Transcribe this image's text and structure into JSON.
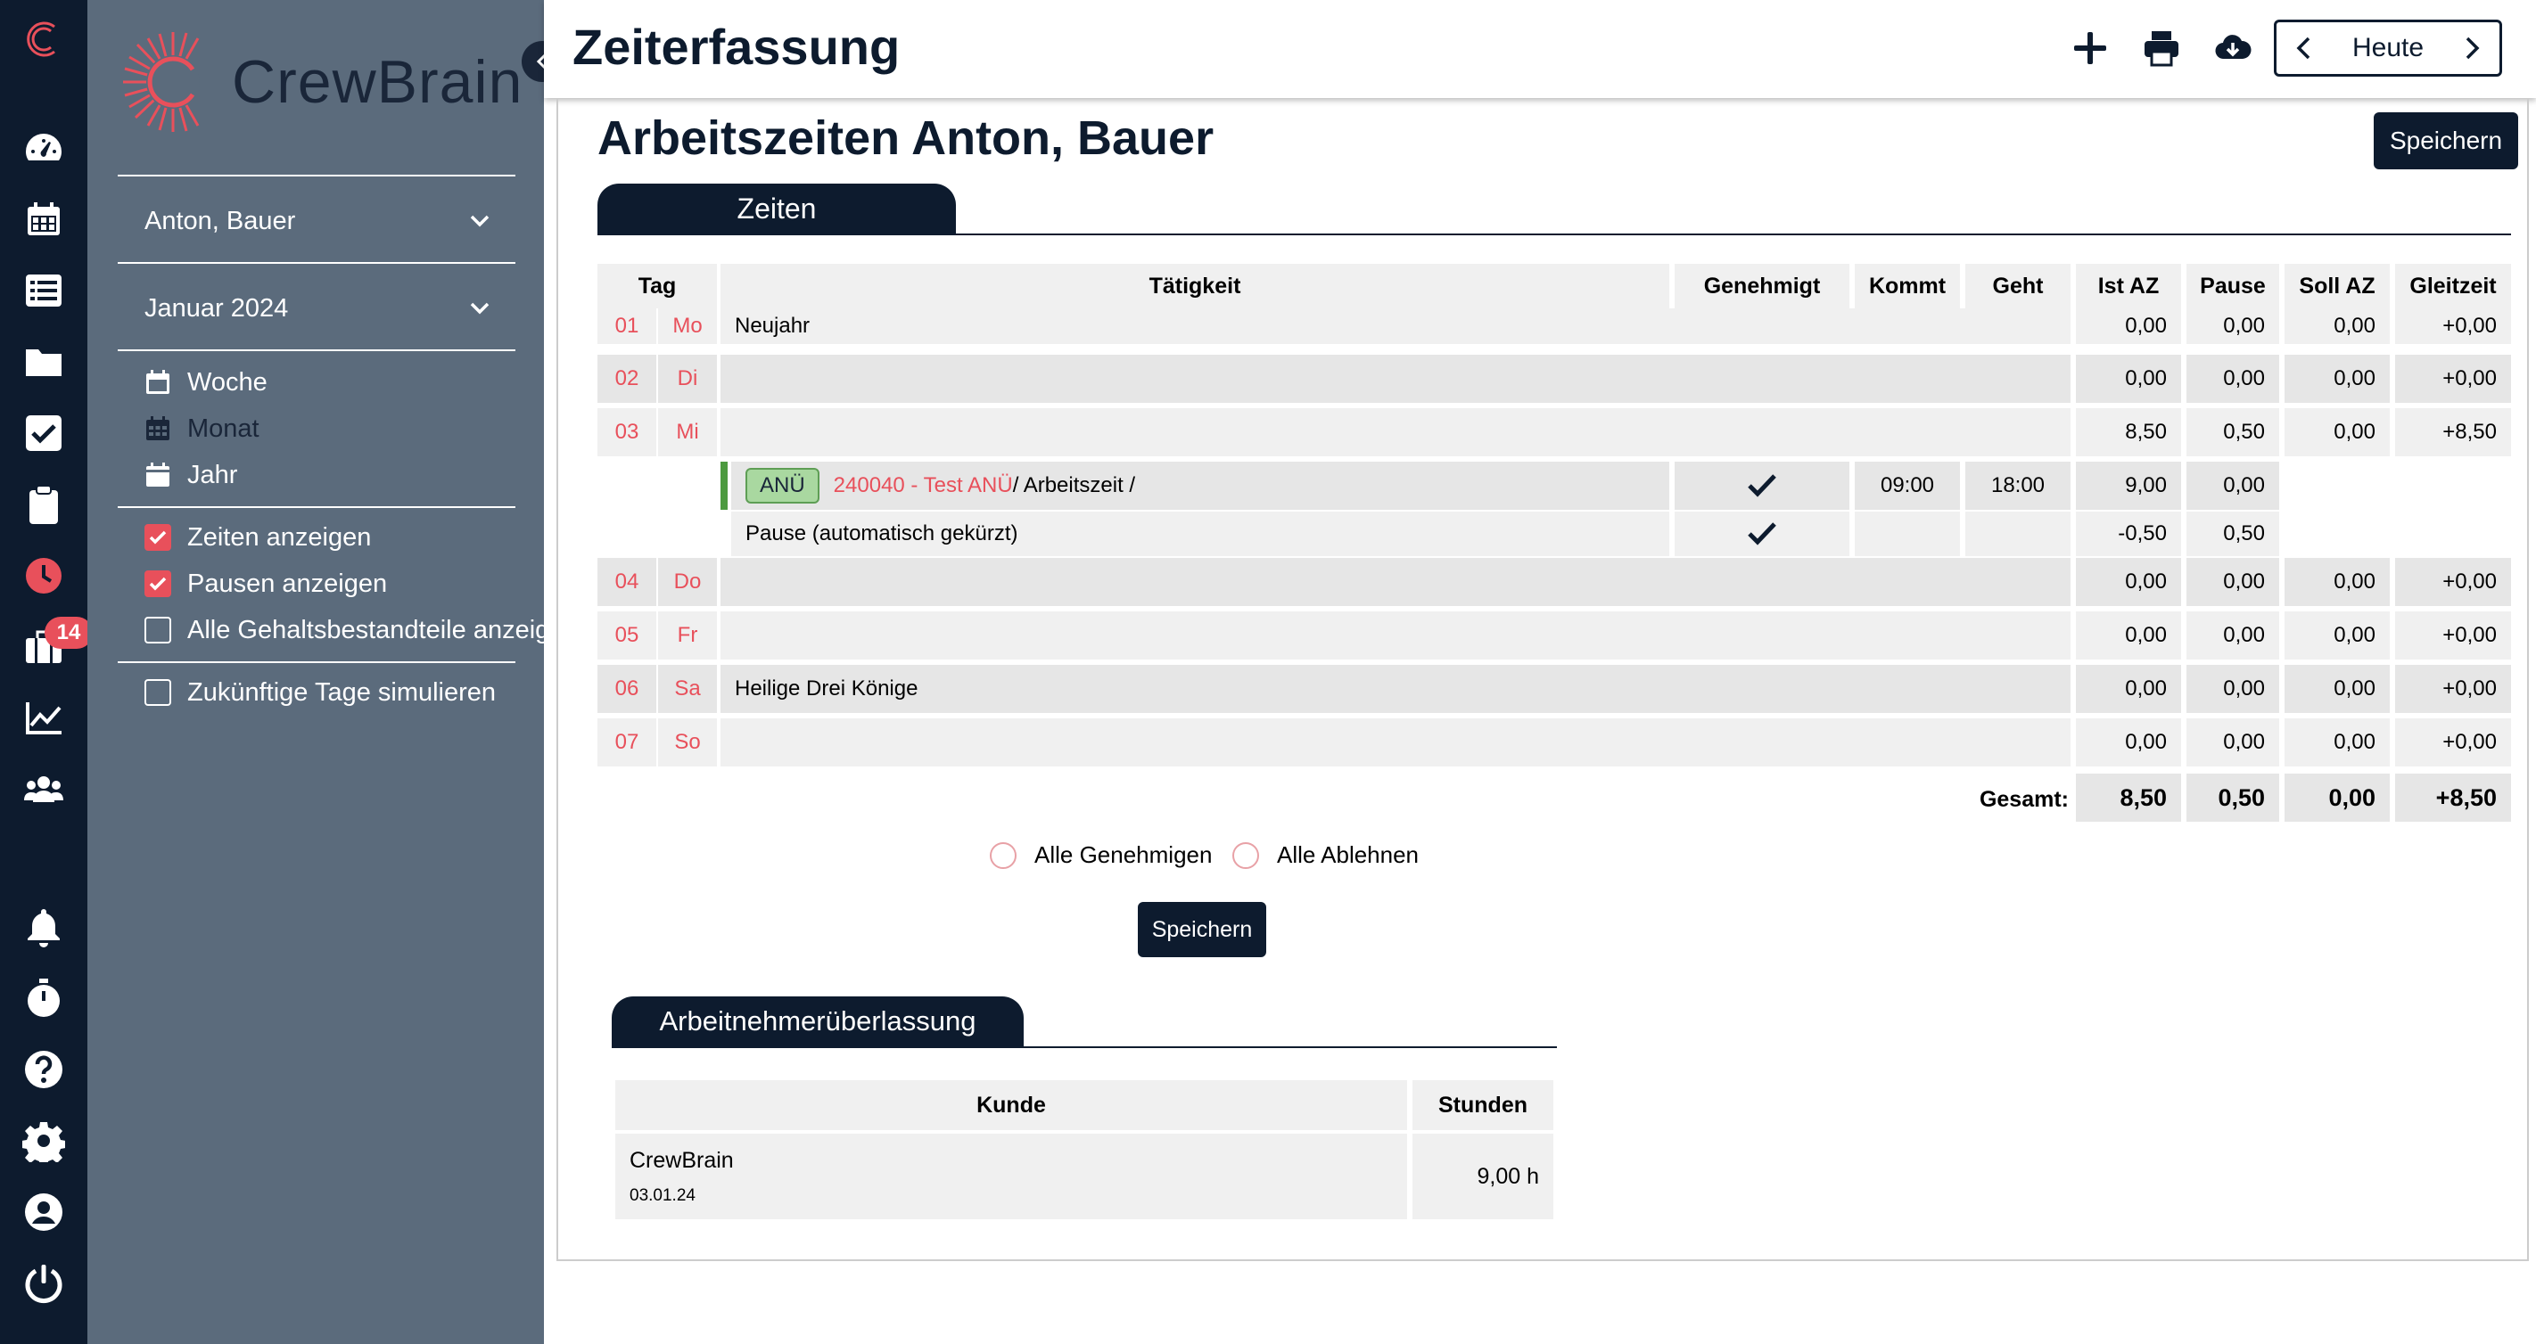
{
  "app": {
    "logo_text": "CrewBrain",
    "page_title": "Zeiterfassung",
    "notification_count": "14",
    "icons": [
      "crewbrain-logo-icon",
      "dashboard-icon",
      "calendar-icon",
      "list-icon",
      "folder-icon",
      "checkbox-icon",
      "clipboard-icon",
      "clock-icon",
      "briefcase-icon",
      "chart-icon",
      "users-icon",
      "bell-icon",
      "stopwatch-icon",
      "help-icon",
      "settings-icon",
      "user-icon",
      "power-icon"
    ]
  },
  "sidebar": {
    "employee": "Anton, Bauer",
    "month": "Januar 2024",
    "views": [
      {
        "label": "Woche"
      },
      {
        "label": "Monat"
      },
      {
        "label": "Jahr"
      }
    ],
    "options": [
      {
        "label": "Zeiten anzeigen",
        "checked": true
      },
      {
        "label": "Pausen anzeigen",
        "checked": true
      },
      {
        "label": "Alle Gehaltsbestandteile anzeigen",
        "checked": false
      },
      {
        "label": "Zukünftige Tage simulieren",
        "checked": false
      }
    ]
  },
  "toolbar": {
    "today_label": "Heute",
    "icons": [
      "plus-icon",
      "print-icon",
      "cloud-download-icon"
    ]
  },
  "main": {
    "heading": "Arbeitszeiten Anton, Bauer",
    "save_label": "Speichern",
    "tab_label": "Zeiten",
    "columns": {
      "tag": "Tag",
      "taetigkeit": "Tätigkeit",
      "genehmigt": "Genehmigt",
      "kommt": "Kommt",
      "geht": "Geht",
      "ist": "Ist AZ",
      "pause": "Pause",
      "soll": "Soll AZ",
      "gleitzeit": "Gleitzeit"
    },
    "days": [
      {
        "d": "01",
        "wd": "Mo",
        "text": "Neujahr",
        "ist": "0,00",
        "pause": "0,00",
        "soll": "0,00",
        "gleit": "+0,00"
      },
      {
        "d": "02",
        "wd": "Di",
        "text": "",
        "ist": "0,00",
        "pause": "0,00",
        "soll": "0,00",
        "gleit": "+0,00"
      },
      {
        "d": "03",
        "wd": "Mi",
        "text": "",
        "ist": "8,50",
        "pause": "0,50",
        "soll": "0,00",
        "gleit": "+8,50"
      },
      {
        "d": "04",
        "wd": "Do",
        "text": "",
        "ist": "0,00",
        "pause": "0,00",
        "soll": "0,00",
        "gleit": "+0,00"
      },
      {
        "d": "05",
        "wd": "Fr",
        "text": "",
        "ist": "0,00",
        "pause": "0,00",
        "soll": "0,00",
        "gleit": "+0,00"
      },
      {
        "d": "06",
        "wd": "Sa",
        "text": "Heilige Drei Könige",
        "ist": "0,00",
        "pause": "0,00",
        "soll": "0,00",
        "gleit": "+0,00"
      },
      {
        "d": "07",
        "wd": "So",
        "text": "",
        "ist": "0,00",
        "pause": "0,00",
        "soll": "0,00",
        "gleit": "+0,00"
      }
    ],
    "entries": [
      {
        "badge": "ANÜ",
        "project": "240040 - Test ANÜ",
        "suffix": " / Arbeitszeit /",
        "kommt": "09:00",
        "geht": "18:00",
        "ist": "9,00",
        "pause": "0,00"
      },
      {
        "text": "Pause (automatisch gekürzt)",
        "ist": "-0,50",
        "pause": "0,50"
      }
    ],
    "totals": {
      "label": "Gesamt:",
      "ist": "8,50",
      "pause": "0,50",
      "soll": "0,00",
      "gleit": "+8,50"
    },
    "approve_all": "Alle Genehmigen",
    "reject_all": "Alle Ablehnen"
  },
  "anue": {
    "tab_label": "Arbeitnehmerüberlassung",
    "col_kunde": "Kunde",
    "col_stunden": "Stunden",
    "rows": [
      {
        "kunde": "CrewBrain",
        "date": "03.01.24",
        "stunden": "9,00 h"
      }
    ]
  }
}
